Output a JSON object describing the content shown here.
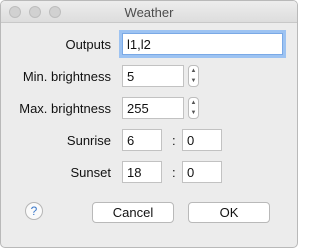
{
  "window": {
    "title": "Weather"
  },
  "fields": {
    "outputs": {
      "label": "Outputs",
      "value": "l1,l2"
    },
    "min_brightness": {
      "label": "Min. brightness",
      "value": "5"
    },
    "max_brightness": {
      "label": "Max. brightness",
      "value": "255"
    },
    "sunrise": {
      "label": "Sunrise",
      "hour": "6",
      "separator": ":",
      "minute": "0"
    },
    "sunset": {
      "label": "Sunset",
      "hour": "18",
      "separator": ":",
      "minute": "0"
    }
  },
  "buttons": {
    "help": "?",
    "cancel": "Cancel",
    "ok": "OK"
  },
  "icons": {
    "stepper_up": "▲",
    "stepper_down": "▼"
  }
}
